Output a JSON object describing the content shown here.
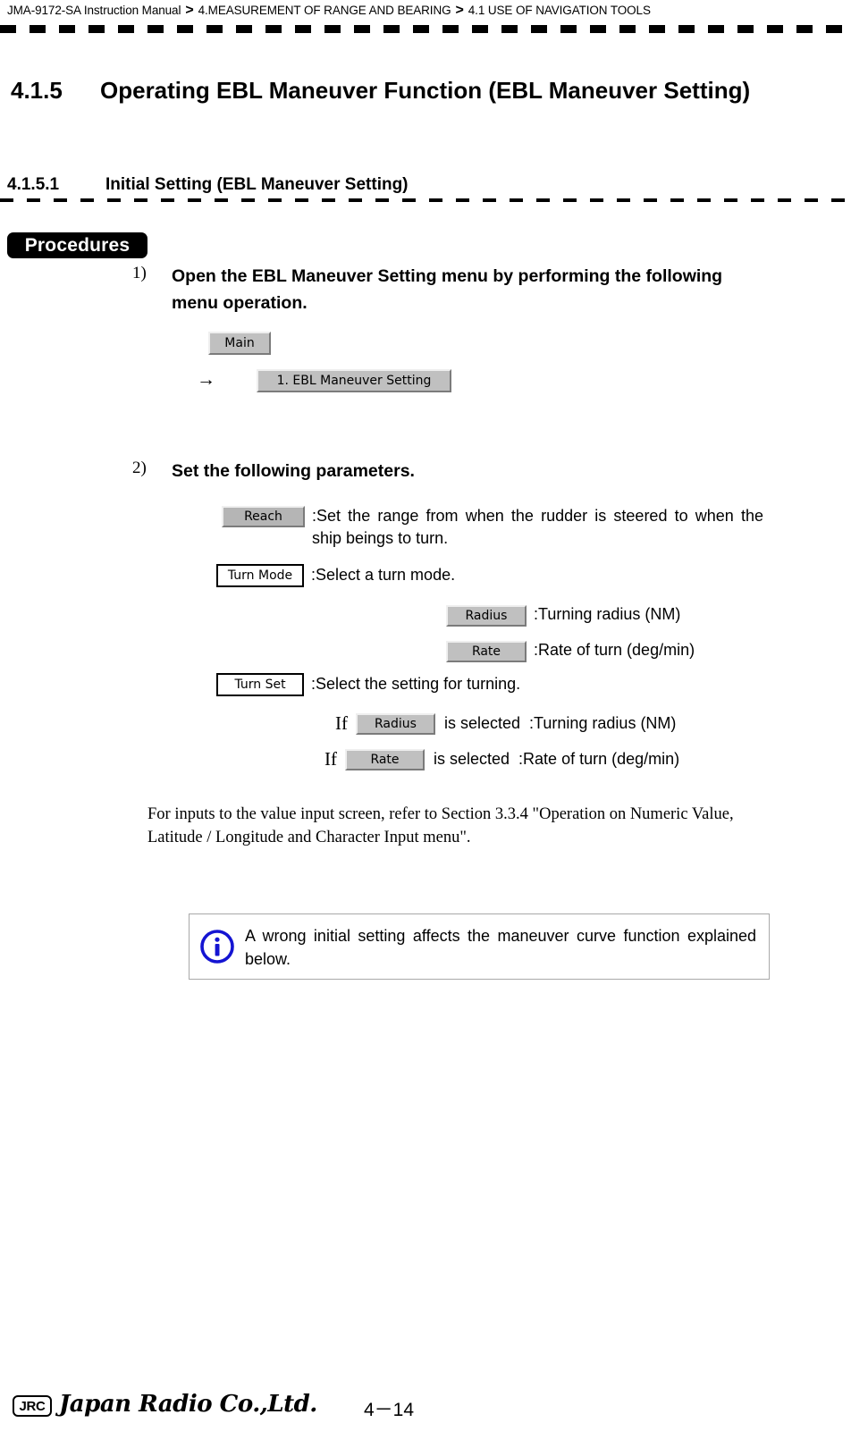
{
  "header": {
    "manual": "JMA-9172-SA Instruction Manual",
    "sep1": ">",
    "chapter": "4.MEASUREMENT OF RANGE AND BEARING",
    "sep2": ">",
    "section": "4.1  USE OF NAVIGATION TOOLS"
  },
  "headings": {
    "h2_number": "4.1.5",
    "h2_title": "Operating EBL Maneuver Function (EBL Maneuver Setting)",
    "h3_number": "4.1.5.1",
    "h3_title": "Initial Setting (EBL Maneuver Setting)"
  },
  "procedures_badge": "Procedures",
  "steps": [
    {
      "marker": "1)",
      "text": "Open the EBL Maneuver Setting menu by performing the following menu operation."
    },
    {
      "marker": "2)",
      "text": "Set the following parameters."
    }
  ],
  "menu_path": {
    "main_button": "Main",
    "arrow": "→",
    "ebl_button": "1. EBL Maneuver Setting"
  },
  "parameters": {
    "reach": {
      "button": "Reach",
      "description": ":Set the range from when the rudder is steered to when the ship beings to turn."
    },
    "turn_mode": {
      "button": "Turn Mode",
      "description": ":Select a turn mode.",
      "options": [
        {
          "button": "Radius",
          "description": ":Turning radius (NM)"
        },
        {
          "button": "Rate",
          "description": ":Rate of turn (deg/min)"
        }
      ]
    },
    "turn_set": {
      "button": "Turn Set",
      "description": ":Select the setting for turning.",
      "conditions": [
        {
          "if_label": "If",
          "button": "Radius",
          "selected_label": "is selected",
          "description": ":Turning radius (NM)"
        },
        {
          "if_label": "If",
          "button": "Rate",
          "selected_label": "is selected",
          "description": ":Rate of turn (deg/min)"
        }
      ]
    }
  },
  "reference_note": "For inputs to the value input screen, refer to Section 3.3.4 \"Operation on Numeric Value, Latitude / Longitude and Character Input menu\".",
  "info_box": {
    "icon": "info-circle-icon",
    "text": "A wrong initial setting affects the maneuver curve function explained below."
  },
  "footer": {
    "logo_mark": "JRC",
    "company": "Japan Radio Co.,Ltd.",
    "page_number": "4－14"
  },
  "colors": {
    "info_blue": "#1414d2",
    "button_face": "#c0c0c0",
    "reach_face": "#b5b5b5",
    "badge_bg": "#000000"
  }
}
